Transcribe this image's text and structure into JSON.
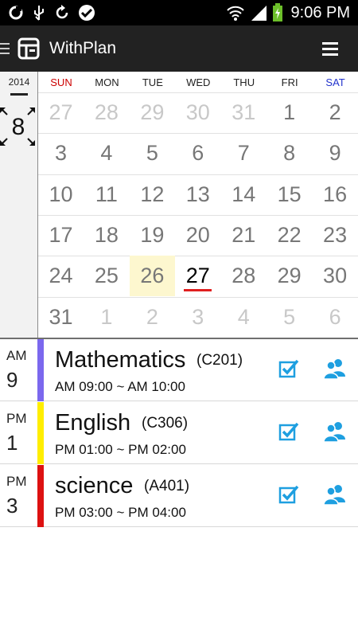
{
  "status_bar": {
    "time": "9:06 PM",
    "icons": [
      "sync-icon",
      "usb-icon",
      "refresh-icon",
      "check-circle-icon",
      "wifi-icon",
      "signal-icon",
      "battery-charging-icon"
    ]
  },
  "app": {
    "title": "WithPlan",
    "logo_icon": "calendar-layout-icon",
    "menu_icon": "hamburger-icon",
    "drawer_icon": "drawer-icon"
  },
  "calendar": {
    "year": "2014",
    "month": "8",
    "weekdays": [
      "SUN",
      "MON",
      "TUE",
      "WED",
      "THU",
      "FRI",
      "SAT"
    ],
    "weekday_colors": [
      "#cc0000",
      "#222222",
      "#222222",
      "#222222",
      "#222222",
      "#222222",
      "#2233cc"
    ],
    "selected_day": "26",
    "today_day": "27",
    "weeks": [
      [
        {
          "d": "27",
          "other": true
        },
        {
          "d": "28",
          "other": true
        },
        {
          "d": "29",
          "other": true
        },
        {
          "d": "30",
          "other": true
        },
        {
          "d": "31",
          "other": true
        },
        {
          "d": "1",
          "other": false
        },
        {
          "d": "2",
          "other": false
        }
      ],
      [
        {
          "d": "3",
          "other": false
        },
        {
          "d": "4",
          "other": false
        },
        {
          "d": "5",
          "other": false
        },
        {
          "d": "6",
          "other": false
        },
        {
          "d": "7",
          "other": false
        },
        {
          "d": "8",
          "other": false
        },
        {
          "d": "9",
          "other": false
        }
      ],
      [
        {
          "d": "10",
          "other": false
        },
        {
          "d": "11",
          "other": false
        },
        {
          "d": "12",
          "other": false
        },
        {
          "d": "13",
          "other": false
        },
        {
          "d": "14",
          "other": false
        },
        {
          "d": "15",
          "other": false
        },
        {
          "d": "16",
          "other": false
        }
      ],
      [
        {
          "d": "17",
          "other": false
        },
        {
          "d": "18",
          "other": false
        },
        {
          "d": "19",
          "other": false
        },
        {
          "d": "20",
          "other": false
        },
        {
          "d": "21",
          "other": false
        },
        {
          "d": "22",
          "other": false
        },
        {
          "d": "23",
          "other": false
        }
      ],
      [
        {
          "d": "24",
          "other": false
        },
        {
          "d": "25",
          "other": false
        },
        {
          "d": "26",
          "other": false
        },
        {
          "d": "27",
          "other": false
        },
        {
          "d": "28",
          "other": false
        },
        {
          "d": "29",
          "other": false
        },
        {
          "d": "30",
          "other": false
        }
      ],
      [
        {
          "d": "31",
          "other": false
        },
        {
          "d": "1",
          "other": true
        },
        {
          "d": "2",
          "other": true
        },
        {
          "d": "3",
          "other": true
        },
        {
          "d": "4",
          "other": true
        },
        {
          "d": "5",
          "other": true
        },
        {
          "d": "6",
          "other": true
        }
      ]
    ]
  },
  "events": [
    {
      "ampm": "AM",
      "hour": "9",
      "subject": "Mathematics",
      "room": "(C201)",
      "time": "AM 09:00 ~ AM 10:00",
      "color": "#7b68ee"
    },
    {
      "ampm": "PM",
      "hour": "1",
      "subject": "English",
      "room": "(C306)",
      "time": "PM 01:00 ~ PM 02:00",
      "color": "#ffee00"
    },
    {
      "ampm": "PM",
      "hour": "3",
      "subject": "science",
      "room": "(A401)",
      "time": "PM 03:00 ~ PM 04:00",
      "color": "#dd1111"
    }
  ],
  "accent_color": "#1e9fe0"
}
